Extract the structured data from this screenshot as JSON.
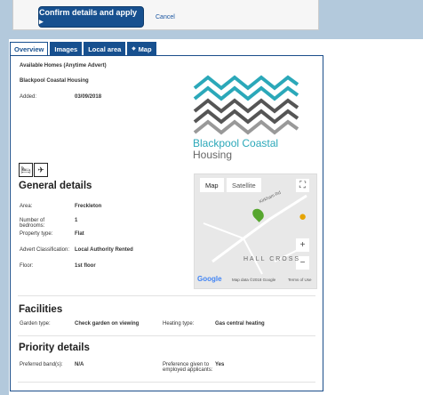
{
  "top": {
    "confirm_label": "Confirm details and apply ▸",
    "cancel_label": "Cancel"
  },
  "tabs": [
    {
      "label": "Overview"
    },
    {
      "label": "Images"
    },
    {
      "label": "Local area"
    },
    {
      "label": "Map"
    }
  ],
  "overview": {
    "advert_type": "Available Homes (Anytime Advert)",
    "landlord": "Blackpool Coastal Housing",
    "added_label": "Added:",
    "added_value": "03/09/2018",
    "logo_line1": "Blackpool Coastal",
    "logo_line2": "Housing"
  },
  "general": {
    "title": "General details",
    "rows": [
      {
        "label": "Area:",
        "value": "Freckleton"
      },
      {
        "label": "Number of bedrooms:",
        "value": "1"
      },
      {
        "label": "Property type:",
        "value": "Flat"
      },
      {
        "label": "Advert Classification:",
        "value": "Local Authority Rented"
      },
      {
        "label": "Floor:",
        "value": "1st floor"
      }
    ]
  },
  "map": {
    "tab_map": "Map",
    "tab_satellite": "Satellite",
    "label_road": "Kirkham Rd",
    "label_place": "HALL CROSS",
    "google": "Google",
    "credits": "Map data ©2018 Google",
    "terms": "Terms of Use"
  },
  "facilities": {
    "title": "Facilities",
    "garden_label": "Garden type:",
    "garden_value": "Check garden on viewing",
    "heating_label": "Heating type:",
    "heating_value": "Gas central heating"
  },
  "priority": {
    "title": "Priority details",
    "band_label": "Preferred band(s):",
    "band_value": "N/A",
    "employed_label": "Preference given to employed applicants:",
    "employed_value": "Yes"
  }
}
